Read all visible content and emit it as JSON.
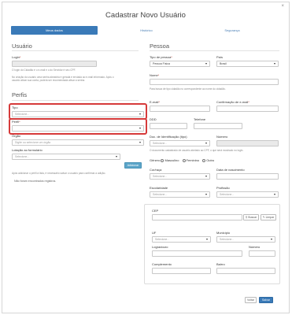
{
  "modal": {
    "title": "Cadastrar Novo Usuário",
    "close": "×"
  },
  "tabs": [
    {
      "label": "Meus dados",
      "active": true
    },
    {
      "label": "Histórico",
      "active": false
    },
    {
      "label": "Segurança",
      "active": false
    }
  ],
  "usuario": {
    "heading": "Usuário",
    "login_label": "Login",
    "login_help": "O login do Cidadão é o e-mail e o do Servidor é seu CPF.",
    "info_line1": "No criação do usuário uma senha aleatória é gerada e enviada ao e-mail informado. Após o",
    "info_line2": "usuário ativar sua conta, poderá ser recomendada ativar a senha."
  },
  "perfis": {
    "heading": "Perfis",
    "tipo_label": "Tipo",
    "tipo_placeholder": "Selecione...",
    "perfil_label": "Perfil",
    "orgao_label": "Órgão",
    "orgao_placeholder": "Digite ou selecione um órgão",
    "lotacao_label": "Lotação ao formulário",
    "lotacao_placeholder": "Selecione...",
    "adicionar": "Adicionar",
    "help": "Após adicionar o perfil à lista, é necessário salvar o usuário para confirmar a adição.",
    "empty": "Não foram encontrados registros."
  },
  "pessoa": {
    "heading": "Pessoa",
    "tipo_pessoa_label": "Tipo de pessoa",
    "tipo_pessoa_value": "Pessoa Física",
    "pais_label": "País",
    "pais_value": "Brasil",
    "nome_label": "Nome",
    "nome_help": "Para busca de tipo cidadão no correspondente ao nome do cidadão.",
    "email_label": "E-mail",
    "email_confirm_label": "Confirmação de e-mail",
    "ddd_label": "DDD",
    "telefone_label": "Telefone",
    "doc_label": "Doc. de Identificação (tipo)",
    "doc_placeholder": "Selecione...",
    "numero_label": "Número",
    "doc_help": "O documento cadastrado de usuário atrelado ao CPF, o que será mostrado no login.",
    "genero_label": "Gênero",
    "genero_options": [
      "Masculino",
      "Feminino",
      "Outro"
    ],
    "cor_label": "Cor/raça",
    "cor_placeholder": "Selecione...",
    "nascimento_label": "Data de nascimento",
    "escolaridade_label": "Escolaridade",
    "escolaridade_placeholder": "Selecione...",
    "profissao_label": "Profissão",
    "profissao_placeholder": "Selecione...",
    "cep_label": "CEP",
    "buscar": "Buscar",
    "limpar": "Limpar",
    "uf_label": "UF",
    "uf_placeholder": "Selecione...",
    "municipio_label": "Município",
    "municipio_placeholder": "Selecione...",
    "logradouro_label": "Logradouro",
    "numero2_label": "Número",
    "complemento_label": "Complemento",
    "bairro_label": "Bairro"
  },
  "footer": {
    "voltar": "Voltar",
    "salvar": "Salvar"
  }
}
